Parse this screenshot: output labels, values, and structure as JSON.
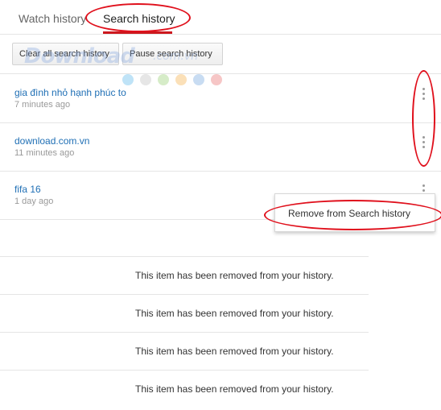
{
  "tabs": {
    "watch_history": "Watch history",
    "search_history": "Search history"
  },
  "toolbar": {
    "clear_all": "Clear all search history",
    "pause": "Pause search history"
  },
  "watermark": {
    "logo": "Download",
    "domain": ".com.vn",
    "dot_colors": [
      "#bfe3f7",
      "#e6e6e6",
      "#d6ecc8",
      "#fbe0b8",
      "#c8dcf2",
      "#f6c6c6"
    ]
  },
  "history": [
    {
      "title": "gia đình nhỏ hạnh phúc to",
      "time": "7 minutes ago"
    },
    {
      "title": "download.com.vn",
      "time": "11 minutes ago"
    },
    {
      "title": "fifa 16",
      "time": "1 day ago"
    }
  ],
  "popup": {
    "remove": "Remove from Search history"
  },
  "removed_message": "This item has been removed from your history.",
  "colors": {
    "accent": "#cc181e",
    "link": "#1f6fb5",
    "annotation": "#e0101c"
  }
}
